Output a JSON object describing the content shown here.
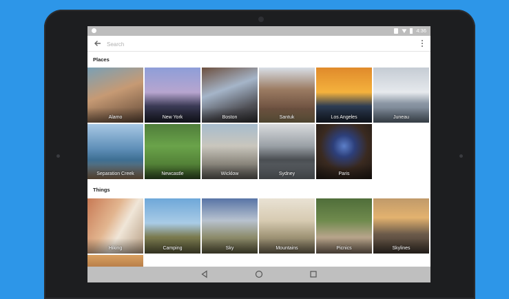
{
  "status": {
    "time": "4:36"
  },
  "search": {
    "placeholder": "Search"
  },
  "sections": {
    "places": {
      "title": "Places",
      "items": [
        {
          "label": "Alamo"
        },
        {
          "label": "New York"
        },
        {
          "label": "Boston"
        },
        {
          "label": "Santuk"
        },
        {
          "label": "Los Angeles"
        },
        {
          "label": "Juneau"
        },
        {
          "label": "Separation Creek"
        },
        {
          "label": "Newcastle"
        },
        {
          "label": "Wicklow"
        },
        {
          "label": "Sydney"
        },
        {
          "label": "Paris"
        }
      ]
    },
    "things": {
      "title": "Things",
      "items": [
        {
          "label": "Hiking"
        },
        {
          "label": "Camping"
        },
        {
          "label": "Sky"
        },
        {
          "label": "Mountains"
        },
        {
          "label": "Picnics"
        },
        {
          "label": "Skylines"
        },
        {
          "label": ""
        }
      ]
    }
  },
  "colors": {
    "background": "#2d96e8",
    "device": "#1d1e20",
    "status_bar": "#bdbdbd",
    "nav_bar": "#bfbfbf"
  },
  "icons": {
    "back": "arrow-left-icon",
    "menu": "more-vert-icon",
    "nav_back": "triangle-back-icon",
    "nav_home": "circle-home-icon",
    "nav_recents": "square-recents-icon"
  }
}
